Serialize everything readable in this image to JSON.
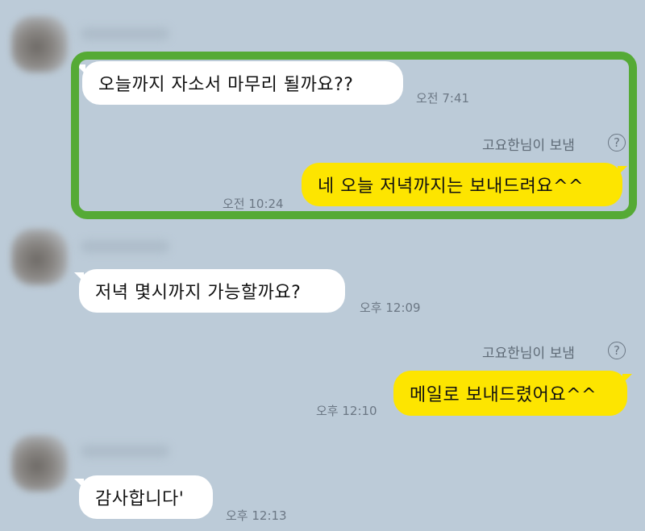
{
  "messages": [
    {
      "text": "오늘까지 자소서 마무리 될까요??",
      "time": "오전 7:41"
    },
    {
      "sender_note": "고요한님이 보냄",
      "help": "?",
      "text": "네 오늘 저녁까지는 보내드려요^^",
      "time": "오전 10:24"
    },
    {
      "text": "저녁 몇시까지 가능할까요?",
      "time": "오후 12:09"
    },
    {
      "sender_note": "고요한님이 보냄",
      "help": "?",
      "text": "메일로 보내드렸어요^^",
      "time": "오후 12:10"
    },
    {
      "text": "감사합니다'",
      "time": "오후 12:13"
    }
  ],
  "colors": {
    "background": "#bccbd8",
    "incoming_bubble": "#ffffff",
    "outgoing_bubble": "#fde500",
    "highlight_border": "#55aa35"
  }
}
